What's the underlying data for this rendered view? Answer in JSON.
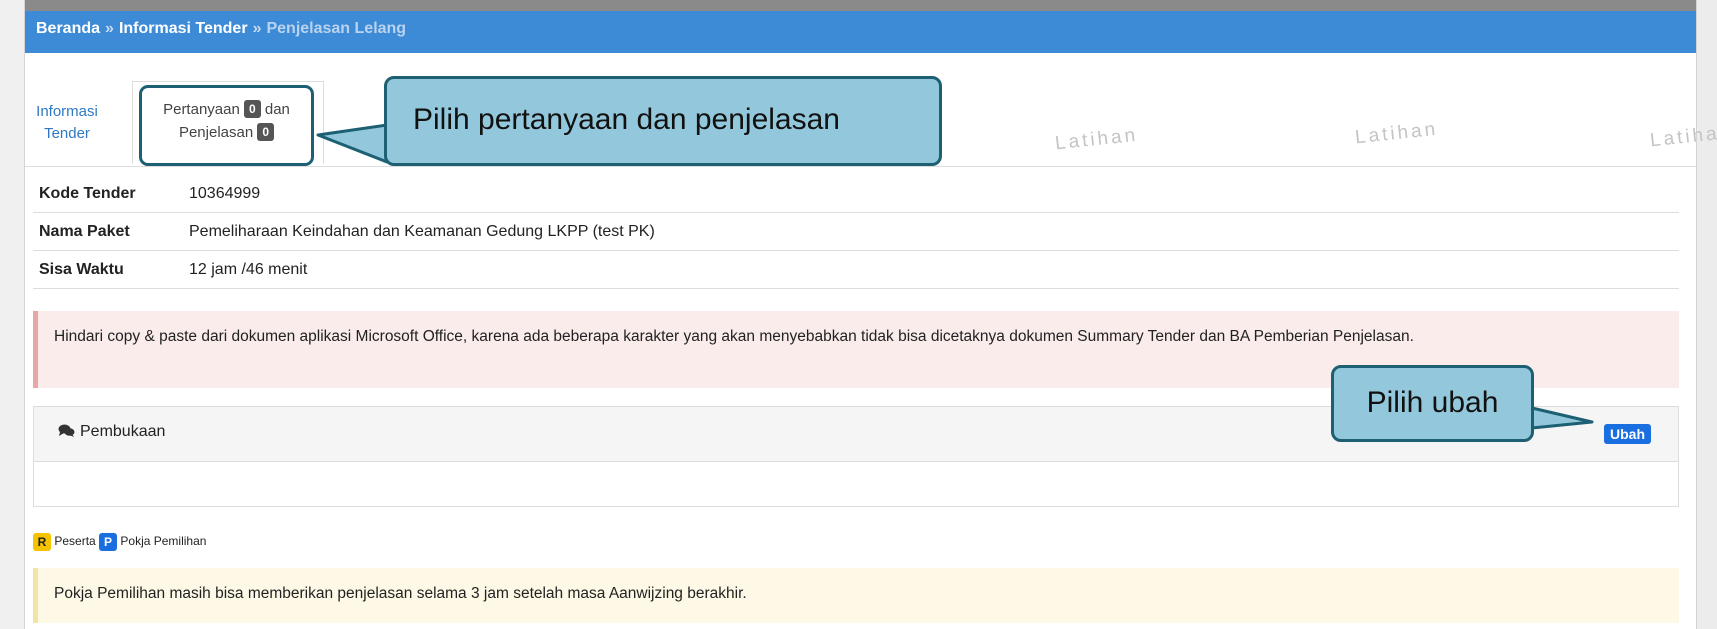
{
  "breadcrumb": {
    "home": "Beranda",
    "separator": "»",
    "section": "Informasi Tender",
    "current": "Penjelasan Lelang"
  },
  "tabs": {
    "info_line1": "Informasi",
    "info_line2": "Tender",
    "qa_line1": "Pertanyaan",
    "qa_count": "0",
    "qa_dan": "dan",
    "qa_line2": "Penjelasan",
    "qa_count2": "0"
  },
  "watermark": "Latihan",
  "callouts": {
    "tab": "Pilih pertanyaan dan penjelasan",
    "ubah": "Pilih ubah"
  },
  "info": {
    "rows": [
      {
        "label": "Kode Tender",
        "value": "10364999"
      },
      {
        "label": "Nama Paket",
        "value": "Pemeliharaan Keindahan dan Keamanan Gedung LKPP (test PK)"
      },
      {
        "label": "Sisa Waktu",
        "value": "12 jam /46 menit"
      }
    ]
  },
  "warning": "Hindari copy & paste dari dokumen aplikasi Microsoft Office, karena ada beberapa karakter yang akan menyebabkan tidak bisa dicetaknya dokumen Summary Tender dan BA Pemberian Penjelasan.",
  "panel": {
    "title": "Pembukaan",
    "button": "Ubah"
  },
  "legend": {
    "r_badge": "R",
    "r_label": "Peserta",
    "p_badge": "P",
    "p_label": "Pokja Pemilihan"
  },
  "note": "Pokja Pemilihan masih bisa memberikan penjelasan selama 3 jam setelah masa Aanwijzing berakhir.",
  "colors": {
    "header": "#3d8ad6",
    "callout_fill": "#93c8dc",
    "callout_border": "#1d5f73",
    "ubah_button": "#1a6fe0",
    "warning_bg": "#fbecec",
    "note_bg": "#fdf9e6"
  }
}
